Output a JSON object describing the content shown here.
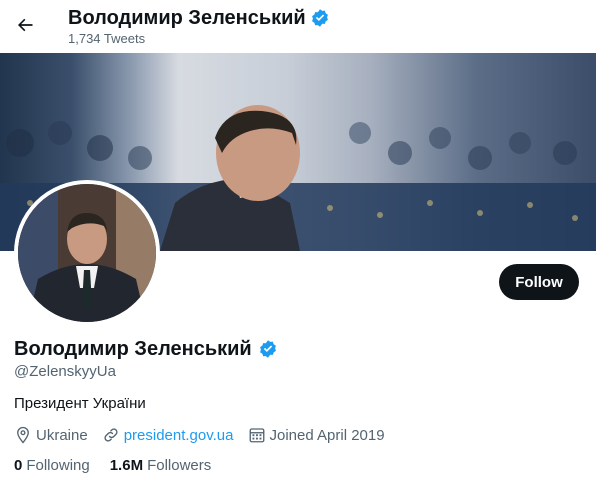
{
  "header": {
    "name": "Володимир Зеленський",
    "tweet_count": "1,734 Tweets"
  },
  "profile": {
    "name": "Володимир Зеленський",
    "handle": "@ZelenskyyUa",
    "bio": "Президент України",
    "location": "Ukraine",
    "website": "president.gov.ua",
    "joined": "Joined April 2019",
    "following_count": "0",
    "following_label": "Following",
    "followers_count": "1.6M",
    "followers_label": "Followers"
  },
  "actions": {
    "follow_label": "Follow"
  },
  "icons": {
    "back": "arrow-left-icon",
    "verified": "verified-badge-icon",
    "location": "location-pin-icon",
    "link": "link-icon",
    "calendar": "calendar-icon"
  },
  "colors": {
    "accent": "#1d9bf0",
    "text": "#0f1419",
    "muted": "#536471",
    "button": "#0f1419"
  }
}
